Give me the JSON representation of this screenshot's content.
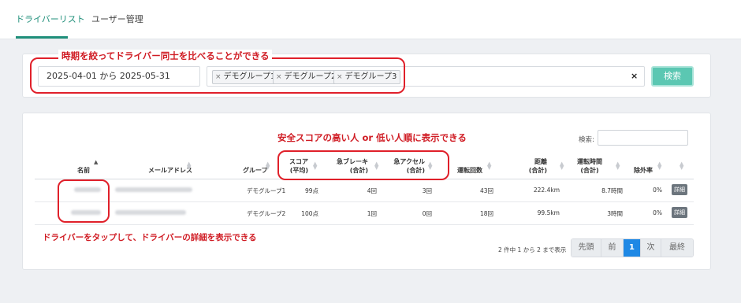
{
  "tabs": [
    {
      "label": "ドライバーリスト",
      "active": true
    },
    {
      "label": "ユーザー管理",
      "active": false
    }
  ],
  "filter": {
    "date_range": "2025-04-01 から 2025-05-31",
    "groups": [
      "デモグループ1",
      "デモグループ2",
      "デモグループ3"
    ],
    "chip_remove": "×",
    "clear": "×",
    "search_button": "検索",
    "callout": "時期を絞ってドライバー同士を比べることができる"
  },
  "table": {
    "search_label": "検索:",
    "headers": {
      "name": "名前",
      "email": "メールアドレス",
      "group": "グループ",
      "score_l1": "スコア",
      "score_l2": "(平均)",
      "brake_l1": "急ブレーキ",
      "brake_l2": "(合計)",
      "accel_l1": "急アクセル",
      "accel_l2": "(合計)",
      "drives": "運転回数",
      "distance_l1": "距離",
      "distance_l2": "(合計)",
      "time_l1": "運転時間",
      "time_l2": "(合計)",
      "excluded": "除外率"
    },
    "rows": [
      {
        "group": "デモグループ1",
        "score": "99点",
        "brake": "4回",
        "accel": "3回",
        "drives": "43回",
        "distance": "222.4km",
        "time": "8.7時間",
        "excluded": "0%",
        "detail": "詳細"
      },
      {
        "group": "デモグループ2",
        "score": "100点",
        "brake": "1回",
        "accel": "0回",
        "drives": "18回",
        "distance": "99.5km",
        "time": "3時間",
        "excluded": "0%",
        "detail": "詳細"
      }
    ],
    "callout_score": "安全スコアの高い人 or 低い人順に表示できる",
    "callout_detail": "ドライバーをタップして、ドライバーの詳細を表示できる"
  },
  "pagination": {
    "info": "2 件中 1 から 2 まで表示",
    "first": "先頭",
    "prev": "前",
    "current": "1",
    "next": "次",
    "last": "最終"
  },
  "colors": {
    "accent": "#1f8f7a",
    "search_button": "#5bc7b2",
    "callout": "#e0202a",
    "page_active": "#1e88e5"
  }
}
